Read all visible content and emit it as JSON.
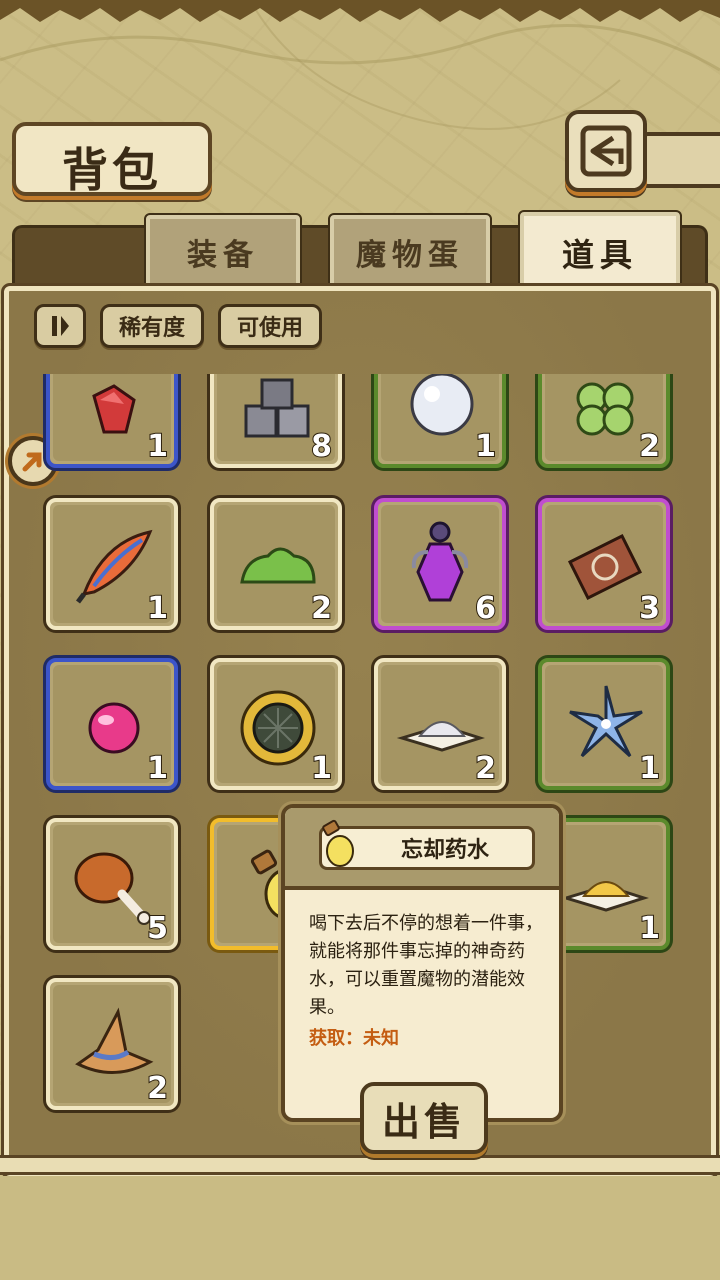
{
  "header": {
    "title": "背包"
  },
  "tabs": [
    {
      "label": "装备",
      "active": false
    },
    {
      "label": "魔物蛋",
      "active": false
    },
    {
      "label": "道具",
      "active": true
    }
  ],
  "toolbar": {
    "sort_label": "稀有度",
    "usable_label": "可使用"
  },
  "items": [
    {
      "name": "ruby-gem",
      "count": "1",
      "rarity": "blue"
    },
    {
      "name": "stone-blocks",
      "count": "8",
      "rarity": "normal"
    },
    {
      "name": "pearl",
      "count": "1",
      "rarity": "green"
    },
    {
      "name": "four-leaf-clover",
      "count": "2",
      "rarity": "green"
    },
    {
      "name": "phoenix-feather",
      "count": "1",
      "rarity": "normal"
    },
    {
      "name": "green-moss",
      "count": "2",
      "rarity": "normal"
    },
    {
      "name": "purple-potion",
      "count": "6",
      "rarity": "purple"
    },
    {
      "name": "rune-ticket",
      "count": "3",
      "rarity": "purple"
    },
    {
      "name": "pink-orb",
      "count": "1",
      "rarity": "blue"
    },
    {
      "name": "woven-nest",
      "count": "1",
      "rarity": "normal"
    },
    {
      "name": "salt-pile",
      "count": "2",
      "rarity": "normal"
    },
    {
      "name": "blue-flower",
      "count": "1",
      "rarity": "green"
    },
    {
      "name": "roast-drumstick",
      "count": "5",
      "rarity": "normal"
    },
    {
      "name": "forget-potion",
      "count": "",
      "rarity": "gold"
    },
    {
      "name": "hidden-item",
      "count": "",
      "rarity": "normal"
    },
    {
      "name": "golden-powder",
      "count": "1",
      "rarity": "green"
    },
    {
      "name": "wizard-hat",
      "count": "2",
      "rarity": "normal"
    }
  ],
  "tooltip": {
    "name": "忘却药水",
    "description": "喝下去后不停的想着一件事，就能将那件事忘掉的神奇药水，可以重置魔物的潜能效果。",
    "source": "获取：未知",
    "sell_label": "出售"
  },
  "colors": {
    "blue": "#3c55c9",
    "green": "#5b8a2c",
    "purple": "#c04ecf",
    "gold": "#f2bd2c",
    "source_text": "#c45d12"
  }
}
